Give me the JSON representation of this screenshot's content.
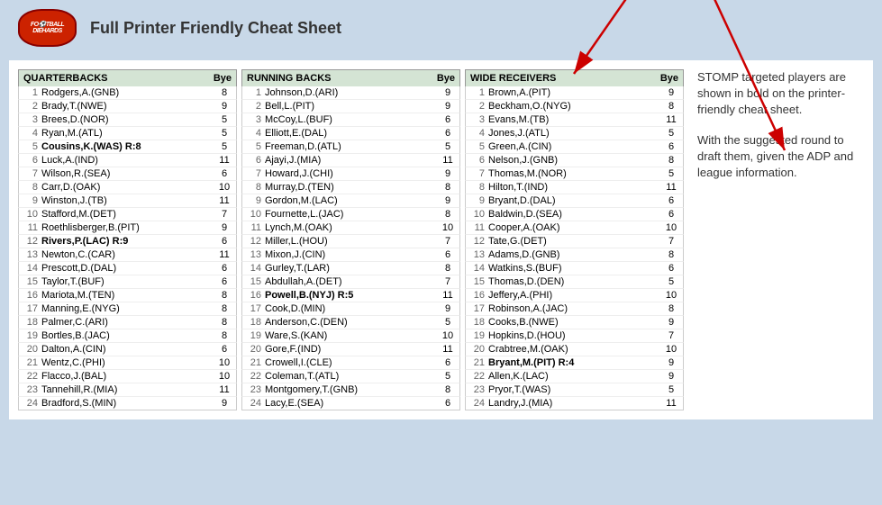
{
  "header": {
    "title": "Full Printer Friendly Cheat Sheet",
    "logo_text": "FOOTBALL\nDIEHARDS"
  },
  "sidebar": {
    "text1": "STOMP targeted players are shown in bold on the printer-friendly cheat sheet.",
    "text2": "With the suggested round to draft them, given the ADP and league information."
  },
  "quarterbacks": {
    "header": "QUARTERBACKS",
    "bye_label": "Bye",
    "players": [
      {
        "num": 1,
        "name": "Rodgers,A.(GNB)",
        "bye": 8,
        "bold": false
      },
      {
        "num": 2,
        "name": "Brady,T.(NWE)",
        "bye": 9,
        "bold": false
      },
      {
        "num": 3,
        "name": "Brees,D.(NOR)",
        "bye": 5,
        "bold": false
      },
      {
        "num": 4,
        "name": "Ryan,M.(ATL)",
        "bye": 5,
        "bold": false
      },
      {
        "num": 5,
        "name": "Cousins,K.(WAS) R:8",
        "bye": 5,
        "bold": true
      },
      {
        "num": 6,
        "name": "Luck,A.(IND)",
        "bye": 11,
        "bold": false
      },
      {
        "num": 7,
        "name": "Wilson,R.(SEA)",
        "bye": 6,
        "bold": false
      },
      {
        "num": 8,
        "name": "Carr,D.(OAK)",
        "bye": 10,
        "bold": false
      },
      {
        "num": 9,
        "name": "Winston,J.(TB)",
        "bye": 11,
        "bold": false
      },
      {
        "num": 10,
        "name": "Stafford,M.(DET)",
        "bye": 7,
        "bold": false
      },
      {
        "num": 11,
        "name": "Roethlisberger,B.(PIT)",
        "bye": 9,
        "bold": false
      },
      {
        "num": 12,
        "name": "Rivers,P.(LAC) R:9",
        "bye": 6,
        "bold": true
      },
      {
        "num": 13,
        "name": "Newton,C.(CAR)",
        "bye": 11,
        "bold": false
      },
      {
        "num": 14,
        "name": "Prescott,D.(DAL)",
        "bye": 6,
        "bold": false
      },
      {
        "num": 15,
        "name": "Taylor,T.(BUF)",
        "bye": 6,
        "bold": false
      },
      {
        "num": 16,
        "name": "Mariota,M.(TEN)",
        "bye": 8,
        "bold": false
      },
      {
        "num": 17,
        "name": "Manning,E.(NYG)",
        "bye": 8,
        "bold": false
      },
      {
        "num": 18,
        "name": "Palmer,C.(ARI)",
        "bye": 8,
        "bold": false
      },
      {
        "num": 19,
        "name": "Bortles,B.(JAC)",
        "bye": 8,
        "bold": false
      },
      {
        "num": 20,
        "name": "Dalton,A.(CIN)",
        "bye": 6,
        "bold": false
      },
      {
        "num": 21,
        "name": "Wentz,C.(PHI)",
        "bye": 10,
        "bold": false
      },
      {
        "num": 22,
        "name": "Flacco,J.(BAL)",
        "bye": 10,
        "bold": false
      },
      {
        "num": 23,
        "name": "Tannehill,R.(MIA)",
        "bye": 11,
        "bold": false
      },
      {
        "num": 24,
        "name": "Bradford,S.(MIN)",
        "bye": 9,
        "bold": false
      }
    ]
  },
  "running_backs": {
    "header": "RUNNING BACKS",
    "bye_label": "Bye",
    "players": [
      {
        "num": 1,
        "name": "Johnson,D.(ARI)",
        "bye": 9,
        "bold": false
      },
      {
        "num": 2,
        "name": "Bell,L.(PIT)",
        "bye": 9,
        "bold": false
      },
      {
        "num": 3,
        "name": "McCoy,L.(BUF)",
        "bye": 6,
        "bold": false
      },
      {
        "num": 4,
        "name": "Elliott,E.(DAL)",
        "bye": 6,
        "bold": false
      },
      {
        "num": 5,
        "name": "Freeman,D.(ATL)",
        "bye": 5,
        "bold": false
      },
      {
        "num": 6,
        "name": "Ajayi,J.(MIA)",
        "bye": 11,
        "bold": false
      },
      {
        "num": 7,
        "name": "Howard,J.(CHI)",
        "bye": 9,
        "bold": false
      },
      {
        "num": 8,
        "name": "Murray,D.(TEN)",
        "bye": 8,
        "bold": false
      },
      {
        "num": 9,
        "name": "Gordon,M.(LAC)",
        "bye": 9,
        "bold": false
      },
      {
        "num": 10,
        "name": "Fournette,L.(JAC)",
        "bye": 8,
        "bold": false
      },
      {
        "num": 11,
        "name": "Lynch,M.(OAK)",
        "bye": 10,
        "bold": false
      },
      {
        "num": 12,
        "name": "Miller,L.(HOU)",
        "bye": 7,
        "bold": false
      },
      {
        "num": 13,
        "name": "Mixon,J.(CIN)",
        "bye": 6,
        "bold": false
      },
      {
        "num": 14,
        "name": "Gurley,T.(LAR)",
        "bye": 8,
        "bold": false
      },
      {
        "num": 15,
        "name": "Abdullah,A.(DET)",
        "bye": 7,
        "bold": false
      },
      {
        "num": 16,
        "name": "Powell,B.(NYJ) R:5",
        "bye": 11,
        "bold": true
      },
      {
        "num": 17,
        "name": "Cook,D.(MIN)",
        "bye": 9,
        "bold": false
      },
      {
        "num": 18,
        "name": "Anderson,C.(DEN)",
        "bye": 5,
        "bold": false
      },
      {
        "num": 19,
        "name": "Ware,S.(KAN)",
        "bye": 10,
        "bold": false
      },
      {
        "num": 20,
        "name": "Gore,F.(IND)",
        "bye": 11,
        "bold": false
      },
      {
        "num": 21,
        "name": "Crowell,I.(CLE)",
        "bye": 6,
        "bold": false
      },
      {
        "num": 22,
        "name": "Coleman,T.(ATL)",
        "bye": 5,
        "bold": false
      },
      {
        "num": 23,
        "name": "Montgomery,T.(GNB)",
        "bye": 8,
        "bold": false
      },
      {
        "num": 24,
        "name": "Lacy,E.(SEA)",
        "bye": 6,
        "bold": false
      }
    ]
  },
  "wide_receivers": {
    "header": "WIDE RECEIVERS",
    "bye_label": "Bye",
    "players": [
      {
        "num": 1,
        "name": "Brown,A.(PIT)",
        "bye": 9,
        "bold": false
      },
      {
        "num": 2,
        "name": "Beckham,O.(NYG)",
        "bye": 8,
        "bold": false
      },
      {
        "num": 3,
        "name": "Evans,M.(TB)",
        "bye": 11,
        "bold": false
      },
      {
        "num": 4,
        "name": "Jones,J.(ATL)",
        "bye": 5,
        "bold": false
      },
      {
        "num": 5,
        "name": "Green,A.(CIN)",
        "bye": 6,
        "bold": false
      },
      {
        "num": 6,
        "name": "Nelson,J.(GNB)",
        "bye": 8,
        "bold": false
      },
      {
        "num": 7,
        "name": "Thomas,M.(NOR)",
        "bye": 5,
        "bold": false
      },
      {
        "num": 8,
        "name": "Hilton,T.(IND)",
        "bye": 11,
        "bold": false
      },
      {
        "num": 9,
        "name": "Bryant,D.(DAL)",
        "bye": 6,
        "bold": false
      },
      {
        "num": 10,
        "name": "Baldwin,D.(SEA)",
        "bye": 6,
        "bold": false
      },
      {
        "num": 11,
        "name": "Cooper,A.(OAK)",
        "bye": 10,
        "bold": false
      },
      {
        "num": 12,
        "name": "Tate,G.(DET)",
        "bye": 7,
        "bold": false
      },
      {
        "num": 13,
        "name": "Adams,D.(GNB)",
        "bye": 8,
        "bold": false
      },
      {
        "num": 14,
        "name": "Watkins,S.(BUF)",
        "bye": 6,
        "bold": false
      },
      {
        "num": 15,
        "name": "Thomas,D.(DEN)",
        "bye": 5,
        "bold": false
      },
      {
        "num": 16,
        "name": "Jeffery,A.(PHI)",
        "bye": 10,
        "bold": false
      },
      {
        "num": 17,
        "name": "Robinson,A.(JAC)",
        "bye": 8,
        "bold": false
      },
      {
        "num": 18,
        "name": "Cooks,B.(NWE)",
        "bye": 9,
        "bold": false
      },
      {
        "num": 19,
        "name": "Hopkins,D.(HOU)",
        "bye": 7,
        "bold": false
      },
      {
        "num": 20,
        "name": "Crabtree,M.(OAK)",
        "bye": 10,
        "bold": false
      },
      {
        "num": 21,
        "name": "Bryant,M.(PIT) R:4",
        "bye": 9,
        "bold": true
      },
      {
        "num": 22,
        "name": "Allen,K.(LAC)",
        "bye": 9,
        "bold": false
      },
      {
        "num": 23,
        "name": "Pryor,T.(WAS)",
        "bye": 5,
        "bold": false
      },
      {
        "num": 24,
        "name": "Landry,J.(MIA)",
        "bye": 11,
        "bold": false
      }
    ]
  }
}
